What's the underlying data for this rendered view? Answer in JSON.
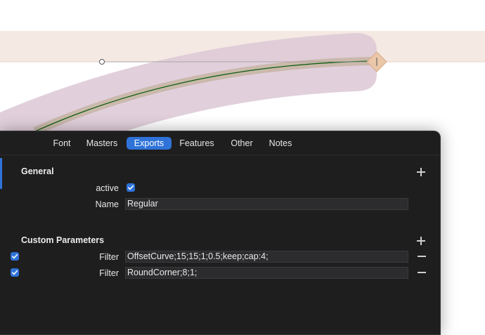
{
  "tabs": [
    {
      "label": "Font",
      "active": false
    },
    {
      "label": "Masters",
      "active": false
    },
    {
      "label": "Exports",
      "active": true
    },
    {
      "label": "Features",
      "active": false
    },
    {
      "label": "Other",
      "active": false
    },
    {
      "label": "Notes",
      "active": false
    }
  ],
  "general": {
    "title": "General",
    "active_label": "active",
    "active_checked": true,
    "name_label": "Name",
    "name_value": "Regular"
  },
  "custom_parameters": {
    "title": "Custom Parameters",
    "rows": [
      {
        "enabled": true,
        "label": "Filter",
        "value": "OffsetCurve;15;15;1;0.5;keep;cap:4;"
      },
      {
        "enabled": true,
        "label": "Filter",
        "value": "RoundCorner;8;1;"
      }
    ]
  },
  "colors": {
    "accent": "#2f73d9",
    "panel_bg": "#1e1e1f",
    "band": "#f3e8e2",
    "stroke_fill": "#dccbd8",
    "curve": "#0a5a0a"
  },
  "icons": [
    "plus-icon",
    "minus-icon",
    "checkbox-icon"
  ]
}
